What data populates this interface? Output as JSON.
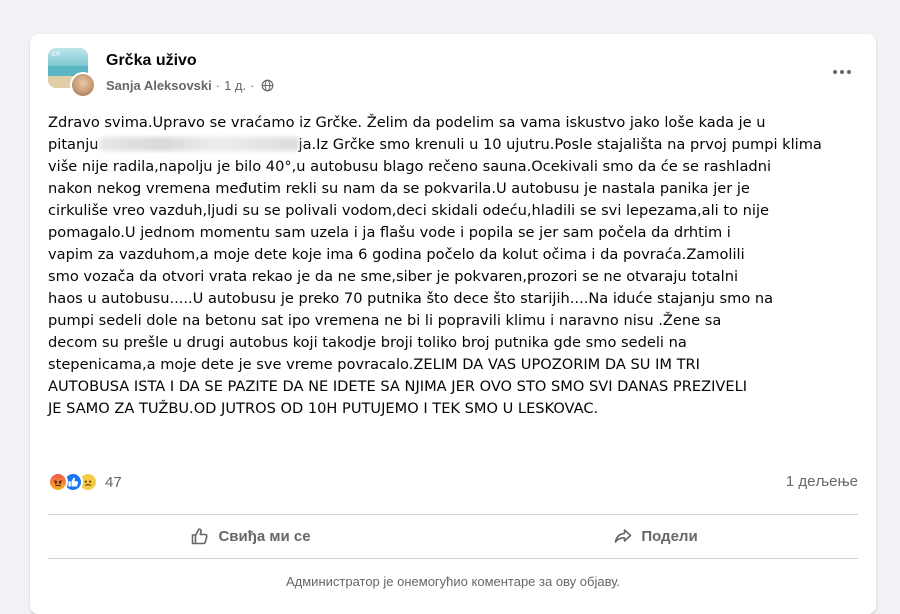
{
  "header": {
    "group_name": "Grčka uživo",
    "author": "Sanja Aleksovski",
    "separator": "·",
    "time": "1 д.",
    "group_avatar_text": "GR"
  },
  "post": {
    "lines": [
      "Zdravo svima.Upravo se vraćamo iz Grčke. Želim da podelim sa vama iskustvo jako loše kada je u",
      "pitanju",
      "ja.Iz Grčke smo krenuli u 10 ujutru.Posle stajališta na prvoj pumpi klima",
      "više nije radila,napolju je bilo 40°,u autobusu blago rečeno sauna.Ocekivali smo da će se rashladni",
      "nakon nekog vremena međutim rekli su nam da se pokvarila.U autobusu je nastala panika jer je",
      "cirkuliše vreo vazduh,ljudi su se polivali vodom,deci skidali odeću,hladili se svi lepezama,ali to nije",
      "pomagalo.U jednom momentu sam uzela i ja flašu vode i popila se jer sam počela da drhtim i",
      "vapim za vazduhom,a moje dete koje ima 6 godina počelo da kolut očima i da povraća.Zamolili",
      "smo vozača da otvori vrata rekao je da ne sme,siber je pokvaren,prozori se ne otvaraju totalni",
      "haos u autobusu.....U autobusu je preko 70 putnika što dece što starijih....Na iduće stajanju smo na",
      "pumpi sedeli dole na betonu sat ipo vremena ne bi li popravili klimu i naravno nisu .Žene sa",
      "decom su prešle u drugi autobus koji takodje broji toliko broj putnika gde smo sedeli na",
      "stepenicama,a moje dete je sve vreme povracalo.ZELIM DA VAS UPOZORIM DA SU IM TRI",
      "AUTOBUSA ISTA I DA SE PAZITE DA NE IDETE SA NJIMA JER OVO STO SMO SVI DANAS PREZIVELI",
      "JE SAMO ZA TUŽBU.OD JUTROS OD 10H PUTUJEMO I TEK SMO U LESKOVAC."
    ]
  },
  "stats": {
    "reaction_count": "47",
    "shares": "1 дељење",
    "reactions": [
      "angry",
      "like",
      "sad"
    ]
  },
  "actions": {
    "like_label": "Свиђа ми се",
    "share_label": "Подели"
  },
  "footer": {
    "comments_disabled": "Администратор је онемогућио коментаре за ову објаву."
  },
  "colors": {
    "background": "#f0f2f5",
    "card": "#ffffff",
    "secondary_text": "#65676b",
    "like_blue": "#1877f2"
  }
}
